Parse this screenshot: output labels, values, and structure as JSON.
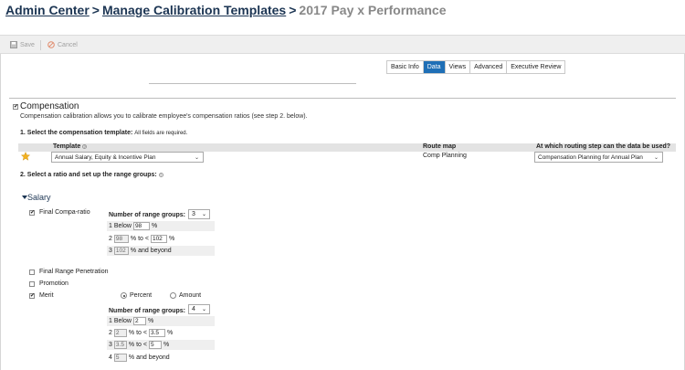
{
  "breadcrumb": {
    "items": [
      "Admin Center",
      "Manage Calibration Templates"
    ],
    "separator": ">",
    "current": "2017 Pay x Performance"
  },
  "toolbar": {
    "save_label": "Save",
    "cancel_label": "Cancel"
  },
  "tabs": [
    {
      "label": "Basic Info",
      "active": false
    },
    {
      "label": "Data",
      "active": true
    },
    {
      "label": "Views",
      "active": false
    },
    {
      "label": "Advanced",
      "active": false
    },
    {
      "label": "Executive Review",
      "active": false
    }
  ],
  "compensation": {
    "checkbox_checked": true,
    "title": "Compensation",
    "description": "Compensation calibration allows you to calibrate employee's compensation ratios (see step 2. below).",
    "step1": {
      "label": "1. Select the compensation template:",
      "note": "All fields are required."
    },
    "table": {
      "headers": {
        "template": "Template",
        "route_map": "Route map",
        "routing_step": "At which routing step can the data be used?"
      },
      "template_value": "Annual Salary, Equity & Incentive Plan",
      "route_map_value": "Comp Planning",
      "routing_step_value": "Compensation Planning for Annual Plan"
    },
    "step2": {
      "label": "2. Select a ratio and set up the range groups:"
    }
  },
  "salary": {
    "title": "Salary",
    "final_compa_ratio": {
      "label": "Final Compa-ratio",
      "checked": true,
      "groups_label": "Number of range groups:",
      "groups_value": "3",
      "rows": [
        {
          "num": "1",
          "prefix": "Below",
          "v1": "98",
          "mid": "",
          "v2": "",
          "suffix": "%"
        },
        {
          "num": "2",
          "prefix": "",
          "v1": "98",
          "mid": "% to <",
          "v2": "102",
          "suffix": "%"
        },
        {
          "num": "3",
          "prefix": "",
          "v1": "102",
          "mid": "% and beyond",
          "v2": "",
          "suffix": ""
        }
      ]
    },
    "final_range_penetration": {
      "label": "Final Range Penetration",
      "checked": false
    },
    "promotion": {
      "label": "Promotion",
      "checked": false
    },
    "merit": {
      "label": "Merit",
      "checked": true,
      "radio_percent": "Percent",
      "radio_amount": "Amount",
      "groups_label": "Number of range groups:",
      "groups_value": "4",
      "rows": [
        {
          "num": "1",
          "prefix": "Below",
          "v1": "2",
          "mid": "",
          "v2": "",
          "suffix": "%"
        },
        {
          "num": "2",
          "v1": "2",
          "mid": "% to <",
          "v2": "3.5",
          "suffix": "%"
        },
        {
          "num": "3",
          "v1": "3.5",
          "mid": "% to <",
          "v2": "5",
          "suffix": "%"
        },
        {
          "num": "4",
          "v1": "5",
          "mid": "% and beyond",
          "v2": "",
          "suffix": ""
        }
      ]
    }
  },
  "colors": {
    "accent": "#1f6fb6",
    "breadcrumb_link": "#1c3553",
    "breadcrumb_current": "#888888",
    "star": "#f2b01e"
  }
}
